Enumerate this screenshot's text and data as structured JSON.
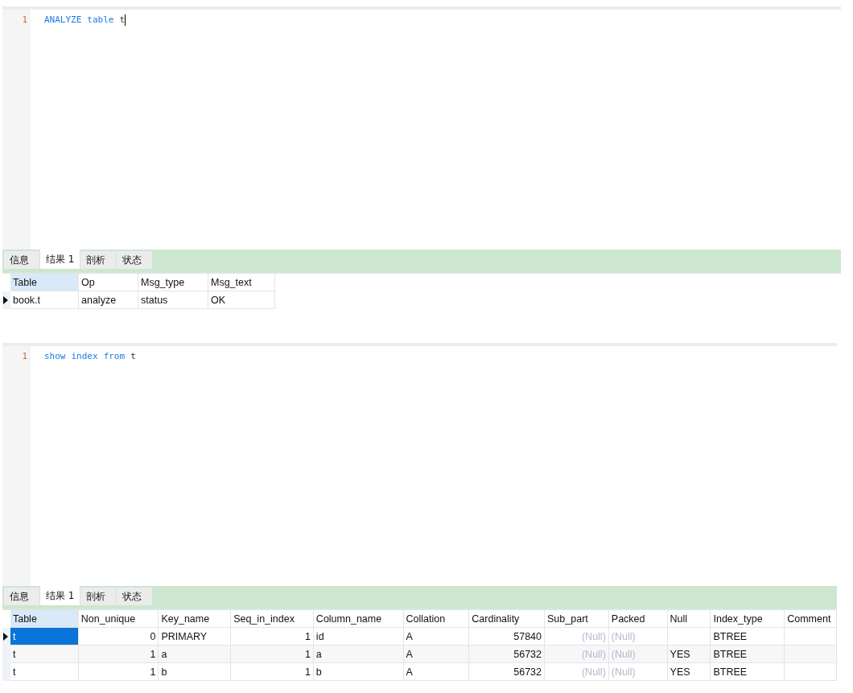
{
  "panels": [
    {
      "editor": {
        "line_number": "1",
        "cursor": true,
        "tokens": [
          {
            "text": "ANALYZE",
            "kind": "keyword"
          },
          {
            "text": "table",
            "kind": "keyword"
          },
          {
            "text": "t",
            "kind": "ident"
          }
        ]
      },
      "tabs": [
        {
          "label": "信息",
          "selected": false
        },
        {
          "label": "结果 1",
          "selected": true
        },
        {
          "label": "剖析",
          "selected": false
        },
        {
          "label": "状态",
          "selected": false
        }
      ],
      "grid": {
        "focused": false,
        "columns": [
          {
            "label": "Table",
            "selected": true
          },
          {
            "label": "Op",
            "selected": false
          },
          {
            "label": "Msg_type",
            "selected": false
          },
          {
            "label": "Msg_text",
            "selected": false
          }
        ],
        "rows": [
          {
            "current": true,
            "cells": [
              "book.t",
              "analyze",
              "status",
              "OK"
            ]
          }
        ]
      }
    },
    {
      "editor": {
        "line_number": "1",
        "cursor": false,
        "tokens": [
          {
            "text": "show",
            "kind": "keyword"
          },
          {
            "text": "index",
            "kind": "keyword"
          },
          {
            "text": "from",
            "kind": "keyword"
          },
          {
            "text": "t",
            "kind": "ident"
          }
        ]
      },
      "tabs": [
        {
          "label": "信息",
          "selected": false
        },
        {
          "label": "结果 1",
          "selected": true
        },
        {
          "label": "剖析",
          "selected": false
        },
        {
          "label": "状态",
          "selected": false
        }
      ],
      "grid": {
        "focused": true,
        "columns": [
          {
            "label": "Table",
            "selected": true
          },
          {
            "label": "Non_unique",
            "selected": false
          },
          {
            "label": "Key_name",
            "selected": false
          },
          {
            "label": "Seq_in_index",
            "selected": false
          },
          {
            "label": "Column_name",
            "selected": false
          },
          {
            "label": "Collation",
            "selected": false
          },
          {
            "label": "Cardinality",
            "selected": false
          },
          {
            "label": "Sub_part",
            "selected": false
          },
          {
            "label": "Packed",
            "selected": false
          },
          {
            "label": "Null",
            "selected": false
          },
          {
            "label": "Index_type",
            "selected": false
          },
          {
            "label": "Comment",
            "selected": false
          }
        ],
        "rows": [
          {
            "current": true,
            "cells": [
              "t",
              "0",
              "PRIMARY",
              "1",
              "id",
              "A",
              "57840",
              {
                "text": "(Null)",
                "null": true
              },
              {
                "text": "(Null)",
                "null": true
              },
              "",
              "BTREE",
              ""
            ]
          },
          {
            "current": false,
            "cells": [
              "t",
              "1",
              "a",
              "1",
              "a",
              "A",
              "56732",
              {
                "text": "(Null)",
                "null": true
              },
              {
                "text": "(Null)",
                "null": true
              },
              "YES",
              "BTREE",
              ""
            ]
          },
          {
            "current": false,
            "cells": [
              "t",
              "1",
              "b",
              "1",
              "b",
              "A",
              "56732",
              {
                "text": "(Null)",
                "null": true
              },
              {
                "text": "(Null)",
                "null": true
              },
              "YES",
              "BTREE",
              ""
            ]
          }
        ]
      }
    }
  ]
}
